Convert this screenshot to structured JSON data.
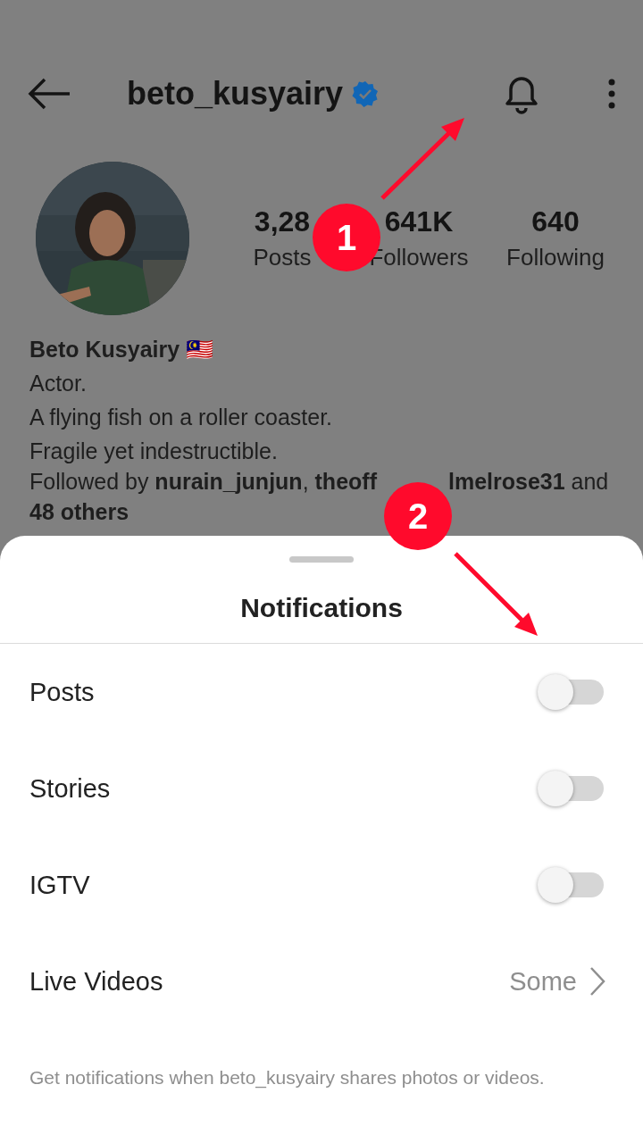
{
  "header": {
    "username": "beto_kusyairy",
    "verified": true
  },
  "stats": [
    {
      "value": "3,28",
      "label": "Posts"
    },
    {
      "value": "641K",
      "label": "Followers"
    },
    {
      "value": "640",
      "label": "Following"
    }
  ],
  "bio": {
    "name": "Beto Kusyairy 🇲🇾",
    "lines": [
      "Actor.",
      "A flying fish on a roller coaster.",
      "Fragile yet indestructible."
    ],
    "followed_by": [
      "Followed by **nurain_junjun**, **theoff**",
      "**lmelrose31** and",
      "**48 others**"
    ]
  },
  "sheet": {
    "title": "Notifications",
    "settings": [
      {
        "label": "Posts",
        "kind": "toggle",
        "on": false
      },
      {
        "label": "Stories",
        "kind": "toggle",
        "on": false
      },
      {
        "label": "IGTV",
        "kind": "toggle",
        "on": false
      },
      {
        "label": "Live Videos",
        "kind": "link",
        "value": "Some"
      }
    ],
    "footer": "Get notifications when beto_kusyairy shares photos or videos."
  },
  "annotations": [
    {
      "number": "1"
    },
    {
      "number": "2"
    }
  ]
}
